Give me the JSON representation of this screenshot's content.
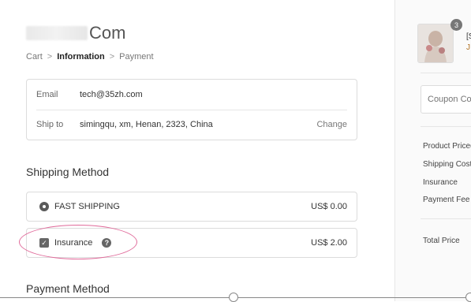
{
  "brand": {
    "name": "Com"
  },
  "breadcrumb": {
    "items": [
      "Cart",
      "Information",
      "Payment"
    ],
    "separator": ">"
  },
  "contact": {
    "email_label": "Email",
    "email_value": "tech@35zh.com",
    "ship_label": "Ship to",
    "ship_value": "simingqu, xm, Henan, 2323, China",
    "change_label": "Change"
  },
  "shipping": {
    "title": "Shipping Method",
    "fast_label": "FAST SHIPPING",
    "fast_price": "US$ 0.00",
    "insurance_label": "Insurance",
    "insurance_price": "US$ 2.00",
    "help_icon": "?",
    "check_glyph": "✓"
  },
  "payment": {
    "title": "Payment Method"
  },
  "summary": {
    "badge_count": "3",
    "product_text_line1": "[S",
    "product_text_line2": "J",
    "coupon_placeholder": "Coupon Cod",
    "rows": [
      "Product Price(",
      "Shipping Cost",
      "Insurance",
      "Payment Fee"
    ],
    "total_label": "Total Price"
  },
  "colors": {
    "highlight_ellipse": "#e06a9a",
    "border": "#dcdcdc"
  },
  "icons": {
    "breadcrumb_separator": "chevron-right-icon",
    "help": "question-circle-icon",
    "radio": "radio-selected-icon",
    "checkbox": "checkbox-checked-icon"
  }
}
